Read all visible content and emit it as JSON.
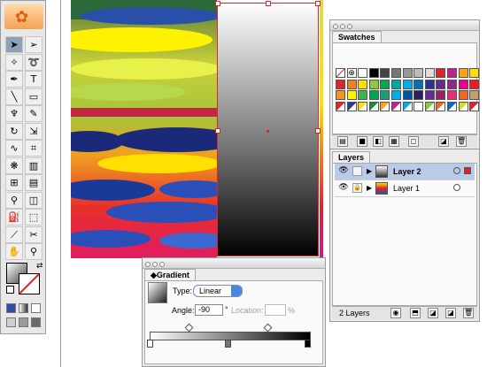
{
  "tools": {
    "logo_icon": "illustrator-flower-logo",
    "buttons": [
      {
        "name": "selection-tool",
        "icon": "arrow-icon",
        "glyph": "➤",
        "selected": true
      },
      {
        "name": "direct-selection-tool",
        "icon": "hollow-arrow-icon",
        "glyph": "➢"
      },
      {
        "name": "magic-wand-tool",
        "icon": "magic-wand-icon",
        "glyph": "✧"
      },
      {
        "name": "lasso-tool",
        "icon": "lasso-icon",
        "glyph": "➰"
      },
      {
        "name": "pen-tool",
        "icon": "pen-icon",
        "glyph": "✒"
      },
      {
        "name": "type-tool",
        "icon": "type-icon",
        "glyph": "T"
      },
      {
        "name": "line-tool",
        "icon": "line-icon",
        "glyph": "╲"
      },
      {
        "name": "rectangle-tool",
        "icon": "rectangle-icon",
        "glyph": "▭"
      },
      {
        "name": "paintbrush-tool",
        "icon": "paintbrush-icon",
        "glyph": "♆"
      },
      {
        "name": "pencil-tool",
        "icon": "pencil-icon",
        "glyph": "✎"
      },
      {
        "name": "rotate-tool",
        "icon": "rotate-icon",
        "glyph": "↻"
      },
      {
        "name": "scale-tool",
        "icon": "scale-icon",
        "glyph": "⇲"
      },
      {
        "name": "warp-tool",
        "icon": "warp-icon",
        "glyph": "∿"
      },
      {
        "name": "free-transform-tool",
        "icon": "free-transform-icon",
        "glyph": "⌗"
      },
      {
        "name": "symbol-sprayer-tool",
        "icon": "symbol-sprayer-icon",
        "glyph": "❋"
      },
      {
        "name": "graph-tool",
        "icon": "graph-icon",
        "glyph": "▥"
      },
      {
        "name": "mesh-tool",
        "icon": "mesh-icon",
        "glyph": "⊞"
      },
      {
        "name": "gradient-tool",
        "icon": "gradient-icon",
        "glyph": "▤"
      },
      {
        "name": "eyedropper-tool",
        "icon": "eyedropper-icon",
        "glyph": "⚲"
      },
      {
        "name": "blend-tool",
        "icon": "blend-icon",
        "glyph": "◫"
      },
      {
        "name": "live-paint-tool",
        "icon": "paint-bucket-icon",
        "glyph": "⛽"
      },
      {
        "name": "live-paint-selection-tool",
        "icon": "live-paint-selection-icon",
        "glyph": "⬚"
      },
      {
        "name": "slice-tool",
        "icon": "slice-icon",
        "glyph": "⟋"
      },
      {
        "name": "scissors-tool",
        "icon": "scissors-icon",
        "glyph": "✂"
      },
      {
        "name": "hand-tool",
        "icon": "hand-icon",
        "glyph": "✋"
      },
      {
        "name": "zoom-tool",
        "icon": "zoom-icon",
        "glyph": "⚲"
      }
    ],
    "fill_icon": "gradient-fill-swatch",
    "stroke_icon": "none-stroke-swatch"
  },
  "swatches": {
    "title": "Swatches",
    "colors": [
      [
        "none",
        "registration",
        "#ffffff",
        "#000000",
        "#444444",
        "#777777",
        "#999999",
        "#bbbbbb",
        "#dddddd",
        "#e0242a",
        "#c81e8c",
        "#ff9f1a",
        "#ffe000"
      ],
      [
        "#e0242a",
        "#f5821f",
        "#ffe000",
        "#8dc63f",
        "#00a651",
        "#00a99d",
        "#00aeef",
        "#0072bc",
        "#2e3192",
        "#662d91",
        "#92278f",
        "#ec008c",
        "#ed1c24"
      ],
      [
        "#f7941d",
        "#fff200",
        "#39b54a",
        "#00a651",
        "#1b9e77",
        "#00aeef",
        "#0054a6",
        "#262262",
        "#662d91",
        "#9e1f63",
        "#ee2a7b",
        "#f26522",
        "#c69c6d"
      ],
      [
        "#e0242a",
        "#2b3990",
        "#ffe000",
        "#1c8a3a",
        "#ff9f1a",
        "#c81e8c",
        "#00aeef",
        "#ffffff",
        "#8dc63f",
        "#f26522",
        "#0072bc",
        "#d7df23",
        "#ed1c24"
      ]
    ]
  },
  "layers": {
    "title": "Layers",
    "rows": [
      {
        "name": "Layer 2",
        "selected": true
      },
      {
        "name": "Layer 1",
        "selected": false
      }
    ],
    "count": "2 Layers"
  },
  "gradient": {
    "title": "Gradient",
    "type_label": "Type:",
    "type_value": "Linear",
    "angle_label": "Angle:",
    "angle_value": "-90",
    "degree_symbol": "°",
    "location_label": "Location:",
    "percent_symbol": "%",
    "start_color": "#ffffff",
    "end_color": "#000000"
  }
}
